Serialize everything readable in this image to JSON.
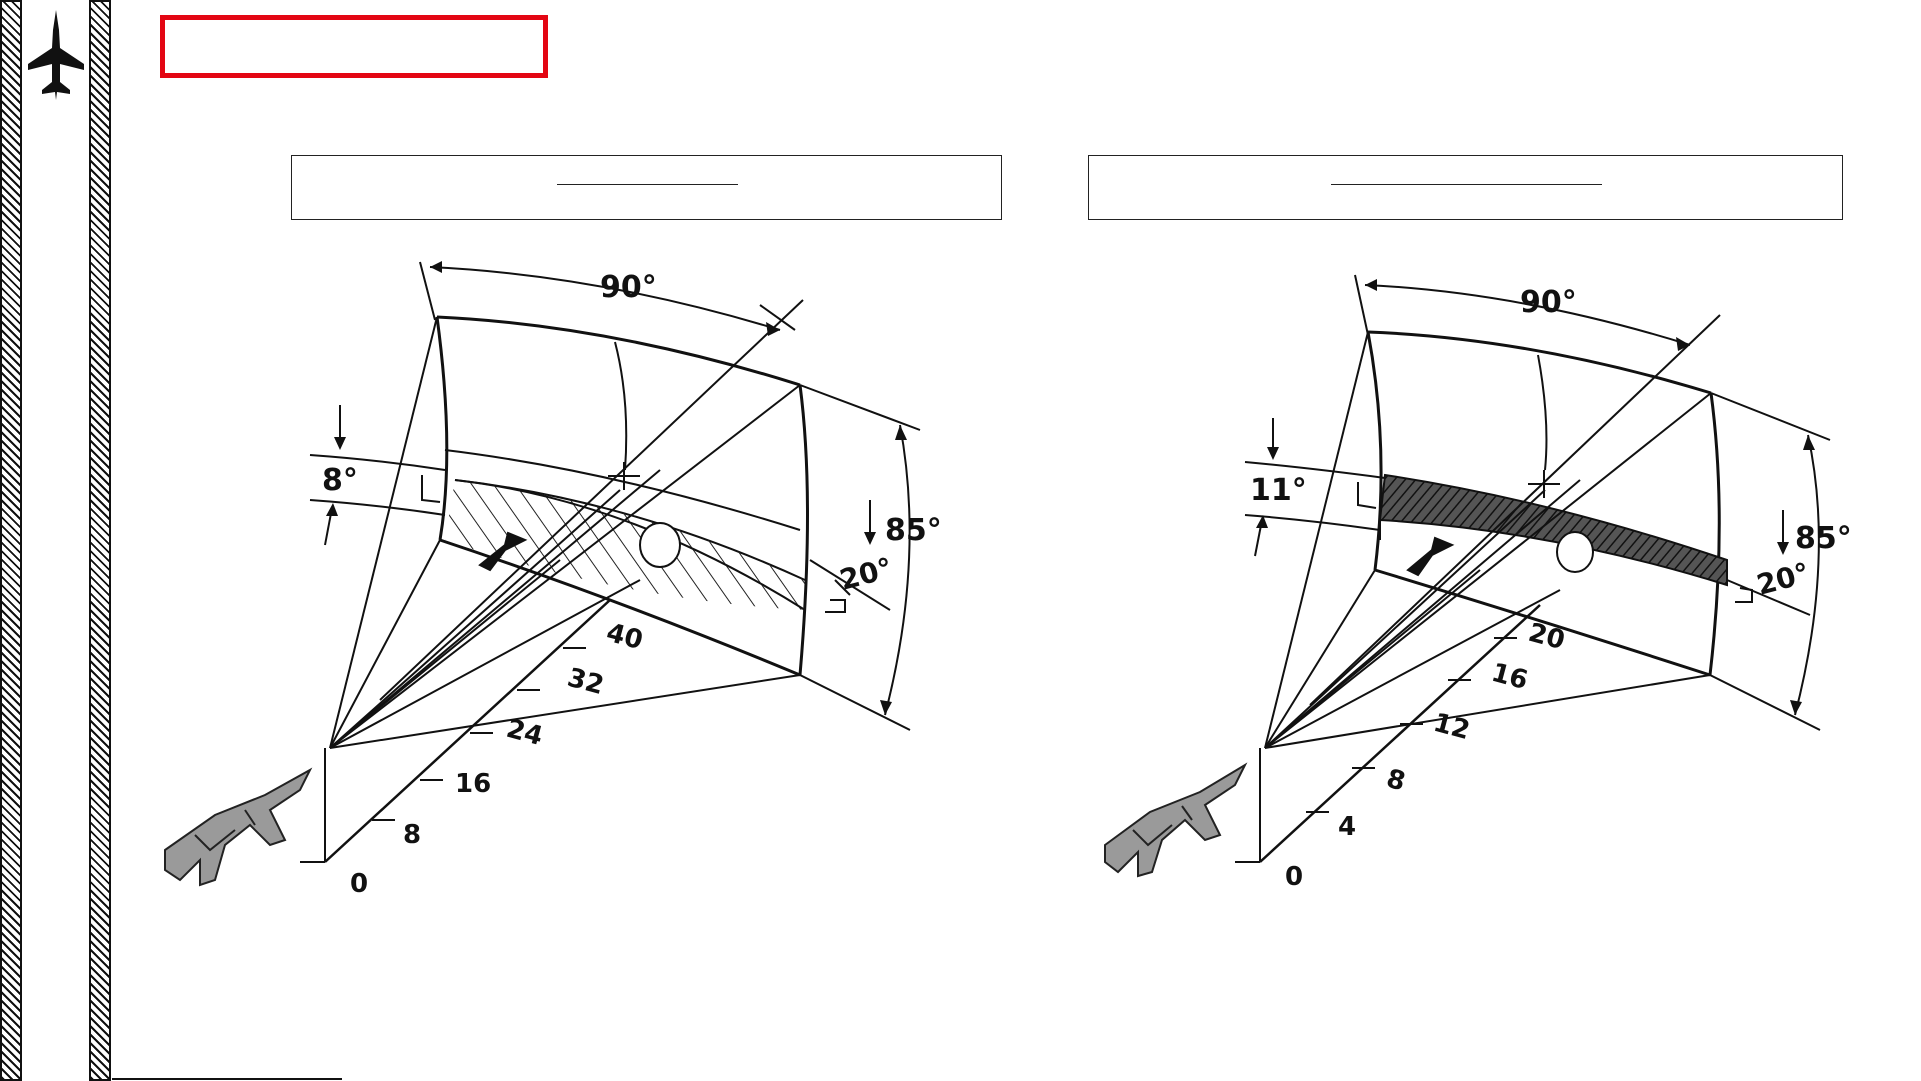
{
  "title": "",
  "panels": [
    {
      "header": "",
      "band_angle": "8°",
      "fov_horizontal": "90°",
      "fov_vertical": "85°",
      "depression": "20°",
      "range_ticks": [
        "0",
        "8",
        "16",
        "24",
        "32",
        "40"
      ]
    },
    {
      "header": "",
      "band_angle": "11°",
      "fov_horizontal": "90°",
      "fov_vertical": "85°",
      "depression": "20°",
      "range_ticks": [
        "0",
        "4",
        "8",
        "12",
        "16",
        "20"
      ]
    }
  ],
  "icons": [
    "fighter-jet-icon",
    "aircraft-illustration"
  ]
}
